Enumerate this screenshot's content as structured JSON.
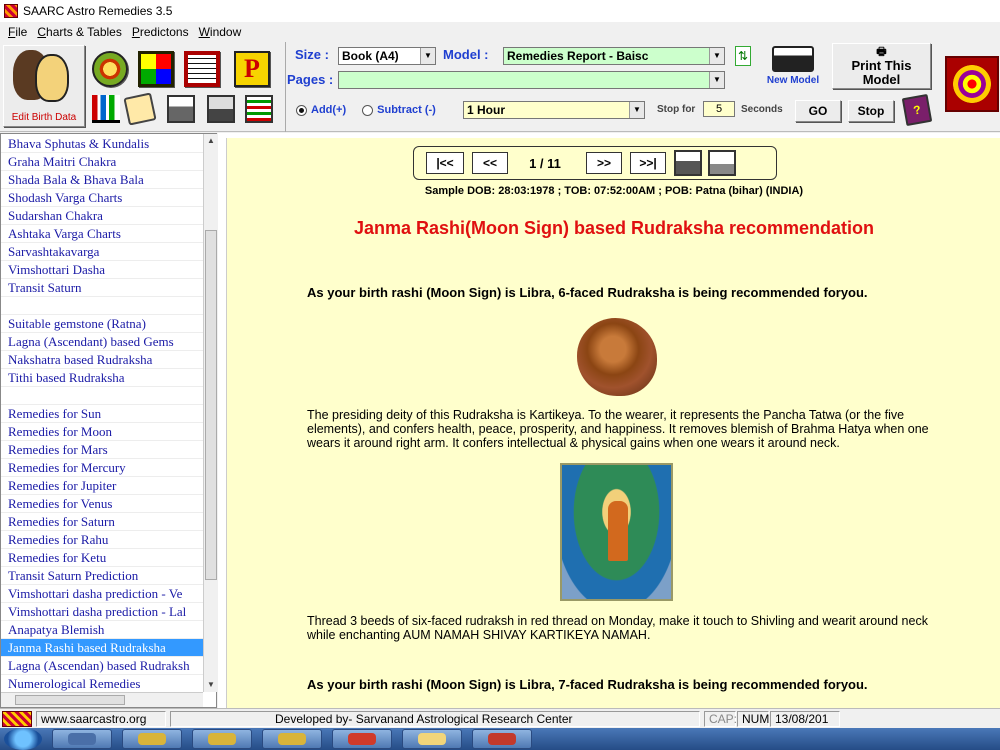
{
  "window": {
    "title": "SAARC Astro Remedies 3.5"
  },
  "menu": [
    "File",
    "Charts & Tables",
    "Predictons",
    "Window"
  ],
  "toolbar": {
    "edit_birth_label": "Edit Birth Data",
    "size_label": "Size :",
    "size_value": "Book (A4)",
    "model_label": "Model :",
    "model_value": "Remedies Report - Baisc",
    "pages_label": "Pages :",
    "pages_value": "",
    "new_model_label": "New Model",
    "print_model_line1": "Print This",
    "print_model_line2": "Model",
    "add_label": "Add(+)",
    "subtract_label": "Subtract (-)",
    "interval_value": "1 Hour",
    "stop_for_label": "Stop for",
    "stop_for_value": "5",
    "seconds_label": "Seconds",
    "go_label": "GO",
    "stop_label": "Stop",
    "selected_mode": "add",
    "icons": [
      "edit-birth-data-icon",
      "om-icon",
      "grid-chart-icon",
      "table-icon",
      "p-icon",
      "bar-chart-icon",
      "book-open-icon",
      "printer-icon",
      "print-icon",
      "color-list-icon",
      "refresh-icon",
      "mandala-icon",
      "help-book-icon"
    ]
  },
  "sidebar": {
    "items": [
      "Bhava Sphutas & Kundalis",
      "Graha Maitri Chakra",
      "Shada Bala & Bhava Bala",
      "Shodash Varga Charts",
      "Sudarshan Chakra",
      "Ashtaka Varga Charts",
      "Sarvashtakavarga",
      "Vimshottari Dasha",
      "Transit Saturn",
      "",
      "Suitable gemstone (Ratna)",
      "Lagna (Ascendant) based Gems",
      "Nakshatra based Rudraksha",
      "Tithi based Rudraksha",
      "",
      "Remedies for Sun",
      "Remedies for Moon",
      "Remedies for Mars",
      "Remedies for Mercury",
      "Remedies for Jupiter",
      "Remedies for Venus",
      "Remedies for Saturn",
      "Remedies for Rahu",
      "Remedies for Ketu",
      "Transit Saturn Prediction",
      "Vimshottari dasha prediction - Ve",
      "Vimshottari dasha prediction - Lal",
      "Anapatya Blemish",
      "Janma Rashi based Rudraksha",
      "Lagna (Ascendan) based Rudraksh",
      "Numerological Remedies"
    ],
    "selected_index": 28
  },
  "pager": {
    "first": "|<<",
    "prev": "<<",
    "count": "1 / 11",
    "next": ">>",
    "last": ">>|"
  },
  "report": {
    "info": "Sample  DOB: 28:03:1978 ; TOB: 07:52:00AM ; POB: Patna (bihar) (INDIA)",
    "heading": "Janma Rashi(Moon Sign) based Rudraksha recommendation",
    "para1": "As your birth rashi (Moon Sign) is Libra, 6-faced Rudraksha is being recommended foryou.",
    "para2": "The presiding deity of this Rudraksha is Kartikeya. To the wearer, it represents the Pancha Tatwa (or the five elements), and confers health, peace, prosperity, and happiness. It removes blemish of Brahma Hatya when one wears it around right arm. It confers intellectual & physical gains when one wears it around neck.",
    "para3": "Thread 3 beeds of six-faced rudraksh in red thread on Monday, make it touch to Shivling and wearit around neck while enchanting AUM NAMAH SHIVAY KARTIKEYA NAMAH.",
    "para4": "As your birth rashi (Moon Sign) is Libra, 7-faced Rudraksha is being recommended foryou."
  },
  "status": {
    "website": "www.saarcastro.org",
    "developer": "Developed by- Sarvanand Astrological Research Center",
    "caps": "CAP:",
    "num": "NUM",
    "date": "13/08/201"
  },
  "taskbar": {
    "items": [
      "start-icon",
      "pen-icon",
      "key-icon",
      "key-icon",
      "key-icon",
      "app-icon",
      "folder-icon",
      "mandala-icon"
    ]
  }
}
